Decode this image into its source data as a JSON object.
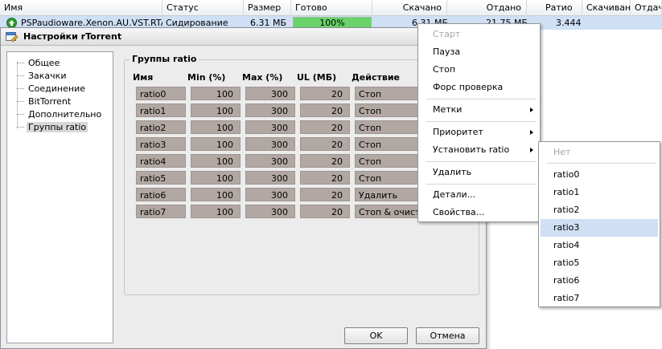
{
  "list": {
    "columns": [
      "Имя",
      "Статус",
      "Размер",
      "Готово",
      "Скачано",
      "Отдано",
      "Ратио",
      "Скачивани",
      "Отдача"
    ],
    "row": {
      "name": "PSPaudioware.Xenon.AU.VST.RTAS",
      "status": "Сидирование",
      "size": "6.31 МБ",
      "done": "100%",
      "done_fraction": 1.0,
      "downloaded": "6.31 МБ",
      "uploaded": "21.75 МБ",
      "ratio": "3.444"
    }
  },
  "dialog": {
    "title": "Настройки rTorrent",
    "tree": [
      "Общее",
      "Закачки",
      "Соединение",
      "BitTorrent",
      "Дополнительно",
      "Группы ratio"
    ],
    "selected_tree_item": "Группы ratio",
    "group_title": "Группы ratio",
    "headers": {
      "name": "Имя",
      "min": "Min (%)",
      "max": "Max (%)",
      "ul": "UL (МБ)",
      "action": "Действие"
    },
    "groups": [
      {
        "name": "ratio0",
        "min": "100",
        "max": "300",
        "ul": "20",
        "action": "Стоп"
      },
      {
        "name": "ratio1",
        "min": "100",
        "max": "300",
        "ul": "20",
        "action": "Стоп"
      },
      {
        "name": "ratio2",
        "min": "100",
        "max": "300",
        "ul": "20",
        "action": "Стоп"
      },
      {
        "name": "ratio3",
        "min": "100",
        "max": "300",
        "ul": "20",
        "action": "Стоп"
      },
      {
        "name": "ratio4",
        "min": "100",
        "max": "300",
        "ul": "20",
        "action": "Стоп"
      },
      {
        "name": "ratio5",
        "min": "100",
        "max": "300",
        "ul": "20",
        "action": "Стоп"
      },
      {
        "name": "ratio6",
        "min": "100",
        "max": "300",
        "ul": "20",
        "action": "Удалить"
      },
      {
        "name": "ratio7",
        "min": "100",
        "max": "300",
        "ul": "20",
        "action": "Стоп & очистить"
      }
    ],
    "ok_label": "OK",
    "cancel_label": "Отмена"
  },
  "context_menu": {
    "items": [
      {
        "label": "Старт",
        "disabled": true
      },
      {
        "label": "Пауза"
      },
      {
        "label": "Стоп"
      },
      {
        "label": "Форс проверка"
      },
      {
        "label": "Метки",
        "submenu": true
      },
      {
        "label": "Приоритет",
        "submenu": true
      },
      {
        "label": "Установить ratio",
        "submenu": true
      },
      {
        "label": "Удалить"
      },
      {
        "label": "Детали..."
      },
      {
        "label": "Свойства..."
      }
    ]
  },
  "ratio_submenu": {
    "none_label": "Нет",
    "items": [
      "ratio0",
      "ratio1",
      "ratio2",
      "ratio3",
      "ratio4",
      "ratio5",
      "ratio6",
      "ratio7"
    ],
    "highlighted": "ratio3"
  },
  "colors": {
    "selection": "#cfe0f5",
    "progress": "#6bd36b",
    "field_bg": "#b2a8a3",
    "seeding_icon": "#2e9a2e"
  }
}
